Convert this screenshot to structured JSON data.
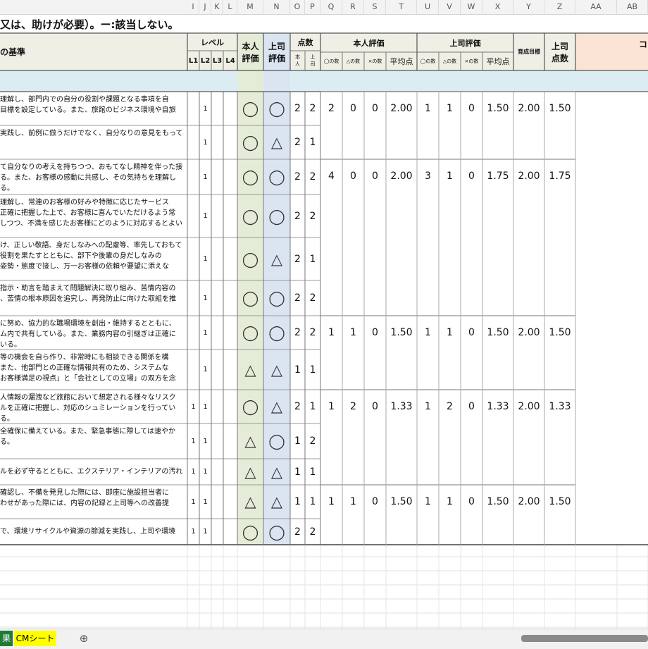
{
  "title_fragment": "又は、助けが必要）。ー:該当しない。",
  "column_letters": [
    "I",
    "J",
    "K",
    "L",
    "M",
    "N",
    "O",
    "P",
    "Q",
    "R",
    "S",
    "T",
    "U",
    "V",
    "W",
    "X",
    "Y",
    "Z",
    "AA",
    "AB"
  ],
  "header": {
    "criteria": "の基準",
    "level": "レベル",
    "levels": [
      "L1",
      "L2",
      "L3",
      "L4"
    ],
    "self_eval": [
      "本人",
      "評価"
    ],
    "boss_eval": [
      "上司",
      "評価"
    ],
    "score": "点数",
    "score_sub1": [
      "本",
      "人"
    ],
    "score_sub2": [
      "上",
      "司"
    ],
    "self_group": "本人評価",
    "boss_group": "上司評価",
    "counts": [
      "◯の数",
      "△の数",
      "×の数"
    ],
    "avg": "平均点",
    "target": "育成目標",
    "boss_score": [
      "上司",
      "点数"
    ],
    "comment_fragment": "コ"
  },
  "rows": [
    {
      "text": [
        "理解し、部門内での自分の役割や課題となる事項を自",
        "目標を設定している。また、旅館のビジネス環境や自旅"
      ],
      "l1": "",
      "l2": "1",
      "self": "◯",
      "boss": "◯",
      "sp": "2",
      "bp": "2"
    },
    {
      "text": [
        "実践し、前例に倣うだけでなく、自分なりの意見をもって"
      ],
      "l1": "",
      "l2": "1",
      "self": "◯",
      "boss": "△",
      "sp": "2",
      "bp": "1"
    },
    {
      "text": [
        "て自分なりの考えを持ちつつ、おもてなし精神を伴った接",
        "る。また、お客様の感動に共感し、その気持ちを理解し",
        "る。"
      ],
      "l1": "",
      "l2": "1",
      "self": "◯",
      "boss": "◯",
      "sp": "2",
      "bp": "2"
    },
    {
      "text": [
        "理解し、常連のお客様の好みや特徴に応じたサービス",
        "正確に把握した上で、お客様に喜んでいただけるよう常",
        "しつつ、不満を感じたお客様にどのように対応するとよい"
      ],
      "l1": "",
      "l2": "1",
      "self": "◯",
      "boss": "◯",
      "sp": "2",
      "bp": "2"
    },
    {
      "text": [
        "け、正しい敬語、身だしなみへの配慮等、率先しておもて",
        "役割を果たすとともに、部下や後輩の身だしなみの",
        "姿勢・態度で接し、万一お客様の依頼や要望に添えな"
      ],
      "l1": "",
      "l2": "1",
      "self": "◯",
      "boss": "△",
      "sp": "2",
      "bp": "1"
    },
    {
      "text": [
        "指示・助言を踏まえて問題解決に取り組み、苦情内容の",
        "、苦情の根本原因を追究し、再発防止に向けた取組を推"
      ],
      "l1": "",
      "l2": "1",
      "self": "◯",
      "boss": "◯",
      "sp": "2",
      "bp": "2"
    },
    {
      "text": [
        "に努め、協力的な職場環境を創出・維持するとともに、",
        "ム内で共有している。また、業務内容の引継ぎは正確に",
        "いる。"
      ],
      "l1": "",
      "l2": "1",
      "self": "◯",
      "boss": "◯",
      "sp": "2",
      "bp": "2"
    },
    {
      "text": [
        "等の機会を自ら作り、非常時にも相談できる関係を構",
        "また、他部門との正確な情報共有のため、システムな",
        "お客様満足の視点」と「会社としての立場」の双方を念"
      ],
      "l1": "",
      "l2": "1",
      "self": "△",
      "boss": "△",
      "sp": "1",
      "bp": "1"
    },
    {
      "text": [
        "人情報の漏洩など旅館において想定される様々なリスク",
        "ルを正確に把握し、対応のシュミレーションを行ってい",
        "る。"
      ],
      "l1": "1",
      "l2": "1",
      "self": "◯",
      "boss": "△",
      "sp": "2",
      "bp": "1"
    },
    {
      "text": [
        "全確保に備えている。また、緊急事態に際しては速やか",
        "る。"
      ],
      "l1": "1",
      "l2": "1",
      "self": "△",
      "boss": "◯",
      "sp": "1",
      "bp": "2"
    },
    {
      "text": [
        "ルを必ず守るとともに、エクステリア・インテリアの汚れ"
      ],
      "l1": "1",
      "l2": "1",
      "self": "△",
      "boss": "△",
      "sp": "1",
      "bp": "1"
    },
    {
      "text": [
        "確認し、不備を発見した際には、即座に施設担当者に",
        "わせがあった際には、内容の記録と上司等への改善提"
      ],
      "l1": "1",
      "l2": "1",
      "self": "△",
      "boss": "△",
      "sp": "1",
      "bp": "1"
    },
    {
      "text": [
        "で、環境リサイクルや資源の節減を実践し、上司や環境"
      ],
      "l1": "1",
      "l2": "1",
      "self": "◯",
      "boss": "◯",
      "sp": "2",
      "bp": "2"
    }
  ],
  "groups": [
    {
      "sc": "2",
      "st": "0",
      "sx": "0",
      "savg": "2.00",
      "bc": "1",
      "bt": "1",
      "bx": "0",
      "bavg": "1.50",
      "target": "2.00",
      "bscore": "1.50"
    },
    {
      "sc": "4",
      "st": "0",
      "sx": "0",
      "savg": "2.00",
      "bc": "3",
      "bt": "1",
      "bx": "0",
      "bavg": "1.75",
      "target": "2.00",
      "bscore": "1.75"
    },
    {
      "sc": "1",
      "st": "1",
      "sx": "0",
      "savg": "1.50",
      "bc": "1",
      "bt": "1",
      "bx": "0",
      "bavg": "1.50",
      "target": "2.00",
      "bscore": "1.50"
    },
    {
      "sc": "1",
      "st": "2",
      "sx": "0",
      "savg": "1.33",
      "bc": "1",
      "bt": "2",
      "bx": "0",
      "bavg": "1.33",
      "target": "2.00",
      "bscore": "1.33"
    },
    {
      "sc": "1",
      "st": "1",
      "sx": "0",
      "savg": "1.50",
      "bc": "1",
      "bt": "1",
      "bx": "0",
      "bavg": "1.50",
      "target": "2.00",
      "bscore": "1.50"
    }
  ],
  "tabs": [
    {
      "label": "果",
      "bg": "#1e7b34",
      "color": "#ffffff"
    },
    {
      "label": "CMシート",
      "bg": "#ffff00",
      "color": "#000000"
    }
  ],
  "add_sheet_icon": "plus-circle-icon",
  "colors": {
    "header_bg": "#efefe6",
    "self_col": "#e4ecd8",
    "boss_col": "#dbe5f1",
    "band": "#dcecf3",
    "comment_bg": "#fbe4d5"
  }
}
